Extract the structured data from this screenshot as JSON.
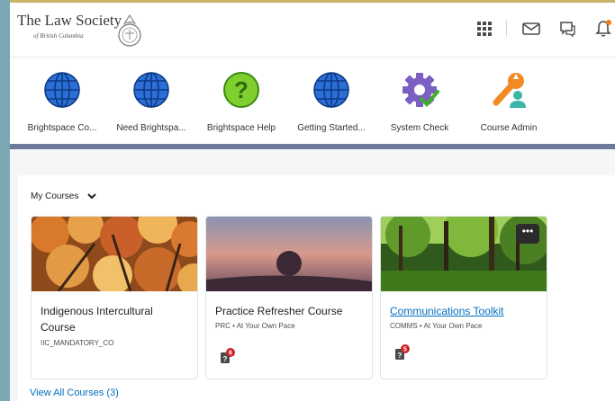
{
  "header": {
    "logo_title": "The Law Society",
    "logo_subtitle": "of British Columbia",
    "icons": [
      "apps-grid-icon",
      "mail-icon",
      "chat-icon",
      "bell-icon"
    ]
  },
  "navbar": {
    "items": [
      {
        "label": "Brightspace Co...",
        "icon": "globe-icon"
      },
      {
        "label": "Need Brightspa...",
        "icon": "globe-icon"
      },
      {
        "label": "Brightspace Help",
        "icon": "help-icon"
      },
      {
        "label": "Getting Started...",
        "icon": "globe-icon"
      },
      {
        "label": "System Check",
        "icon": "gear-check-icon"
      },
      {
        "label": "Course Admin",
        "icon": "wrench-user-icon"
      }
    ]
  },
  "my_courses": {
    "label": "My Courses",
    "courses": [
      {
        "title": "Indigenous Intercultural Course",
        "code": "IIC_MANDATORY_CO",
        "pace": ""
      },
      {
        "title": "Practice Refresher Course",
        "code": "PRC",
        "pace": "At Your Own Pace",
        "badge": "6"
      },
      {
        "title": "Communications Toolkit",
        "code": "COMMS",
        "pace": "At Your Own Pace",
        "badge": "5"
      }
    ],
    "view_all": "View All Courses (3)"
  },
  "colors": {
    "accent": "#006fbf",
    "navbar_bar": "#6e7a99",
    "globe_blue": "#2b6fd6",
    "help_green": "#7fcf2e",
    "gear_purple": "#7b5fc2",
    "admin_orange": "#f08a24"
  }
}
